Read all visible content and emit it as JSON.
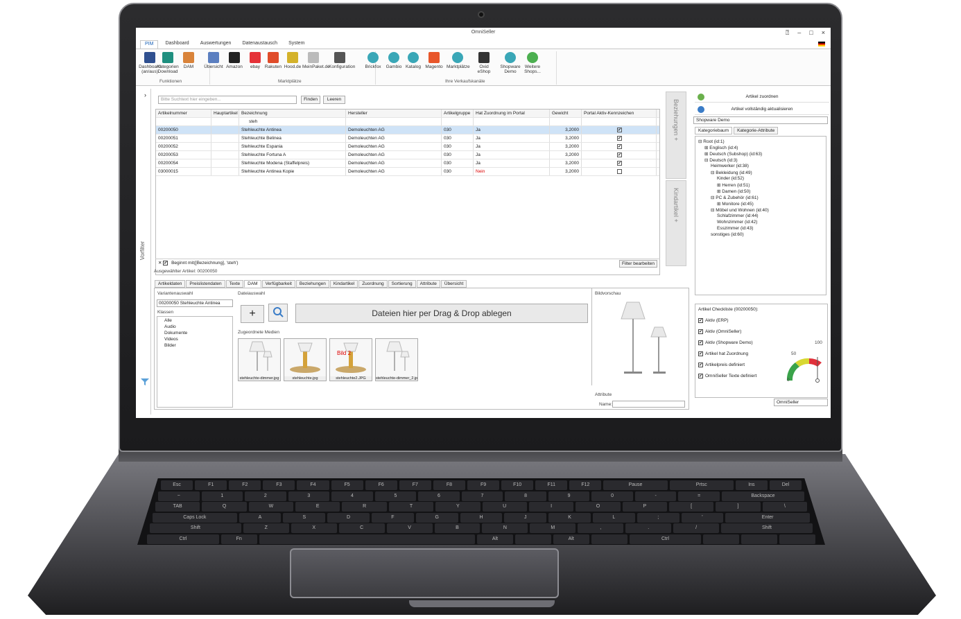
{
  "window": {
    "title": "OmniSeller"
  },
  "menu": [
    "PIM",
    "Dashboard",
    "Auswertungen",
    "Datenaustausch",
    "System"
  ],
  "ribbon": {
    "groups": [
      "Funktionen",
      "Marktplätze",
      "Ihre Verkaufskanäle"
    ],
    "buttons": [
      {
        "label": "Dashboard (an/aus)",
        "icon": "dashboard-icon",
        "color": "#2f4f8f"
      },
      {
        "label": "Kategorien Download",
        "icon": "download-icon",
        "color": "#1f8f7f"
      },
      {
        "label": "DAM",
        "icon": "image-icon",
        "color": "#d9833a"
      },
      {
        "label": "Übersicht",
        "icon": "grid-icon",
        "color": "#5b7fc0"
      },
      {
        "label": "Amazon",
        "icon": "amazon-icon",
        "color": "#222222"
      },
      {
        "label": "ebay",
        "icon": "ebay-icon",
        "color": "#e53238"
      },
      {
        "label": "Rakuten",
        "icon": "cart-icon",
        "color": "#e04c2a"
      },
      {
        "label": "Hood.de",
        "icon": "hood-icon",
        "color": "#d4b22a"
      },
      {
        "label": "MeinPaket.de",
        "icon": "truck-icon",
        "color": "#bbbbbb"
      },
      {
        "label": "Konfiguration",
        "icon": "wrench-icon",
        "color": "#555555"
      },
      {
        "label": "Brickfox",
        "icon": "globe-icon",
        "color": "#3aa7b7"
      },
      {
        "label": "Gambio",
        "icon": "globe-icon",
        "color": "#3aa7b7"
      },
      {
        "label": "Katalog",
        "icon": "globe-icon",
        "color": "#3aa7b7"
      },
      {
        "label": "Magento",
        "icon": "magento-icon",
        "color": "#e8562a"
      },
      {
        "label": "Marktplätze",
        "icon": "globe-icon",
        "color": "#3aa7b7"
      },
      {
        "label": "Oxid eShop",
        "icon": "oxid-icon",
        "color": "#333333"
      },
      {
        "label": "Shopware Demo",
        "icon": "globe-icon",
        "color": "#3aa7b7"
      },
      {
        "label": "Weitere Shops...",
        "icon": "plus-icon",
        "color": "#4caf50"
      }
    ]
  },
  "sidebar": {
    "vorfilter": "Vorfilter"
  },
  "search": {
    "placeholder": "Bitte Suchtext hier eingeben...",
    "find": "Finden",
    "clear": "Leeren"
  },
  "grid": {
    "columns": [
      "Artikelnummer",
      "Hauptartikel",
      "Bezeichnung",
      "Hersteller",
      "Artikelgruppe",
      "Hat Zuordnung im Portal",
      "Gewicht",
      "Portal Aktiv-Kennzeichen"
    ],
    "filter_value": "steh",
    "rows": [
      {
        "nr": "00200050",
        "bez": "Stehleuchte Antinea",
        "herst": "Demoleuchten AG",
        "grp": "030",
        "zuo": "Ja",
        "gew": "3,2000",
        "aktiv": true,
        "nein": false
      },
      {
        "nr": "00200051",
        "bez": "Stehleuchte Belinea",
        "herst": "Demoleuchten AG",
        "grp": "030",
        "zuo": "Ja",
        "gew": "3,2000",
        "aktiv": true,
        "nein": false
      },
      {
        "nr": "00200052",
        "bez": "Stehleuchte Espania",
        "herst": "Demoleuchten AG",
        "grp": "030",
        "zuo": "Ja",
        "gew": "3,2000",
        "aktiv": true,
        "nein": false
      },
      {
        "nr": "00200053",
        "bez": "Stehleuchte Fortuna A",
        "herst": "Demoleuchten AG",
        "grp": "030",
        "zuo": "Ja",
        "gew": "3,2000",
        "aktiv": true,
        "nein": false
      },
      {
        "nr": "00200054",
        "bez": "Stehleuchte Modena (Staffelpreis)",
        "herst": "Demoleuchten AG",
        "grp": "030",
        "zuo": "Ja",
        "gew": "3,2000",
        "aktiv": true,
        "nein": false
      },
      {
        "nr": "03000015",
        "bez": "Stehleuchte Antinea Kopie",
        "herst": "Demoleuchten AG",
        "grp": "030",
        "zuo": "Nein",
        "gew": "3,2000",
        "aktiv": false,
        "nein": true
      }
    ],
    "filter_text": "Beginnt mit([Bezeichnung], 'steh')",
    "filter_edit": "Filter bearbeiten",
    "selected_info": "Ausgewählter Artikel: 00200050"
  },
  "vpanels": {
    "beziehungen": "Beziehungen +",
    "kindartikel": "Kindartikel +"
  },
  "right": {
    "assign": "Artikel zuordnen",
    "update": "Artikel vollständig aktualisieren",
    "shop": "Shopware Demo",
    "tabs": [
      "Kategoriebaum",
      "Kategorie-Attribute"
    ],
    "tree": [
      {
        "label": "Root (id:1)",
        "depth": 0,
        "exp": "⊟"
      },
      {
        "label": "Englisch (id:4)",
        "depth": 1,
        "exp": "⊞"
      },
      {
        "label": "Deutsch (Subshop) (id:63)",
        "depth": 1,
        "exp": "⊞"
      },
      {
        "label": "Deutsch (id:3)",
        "depth": 1,
        "exp": "⊟"
      },
      {
        "label": "Heimwerker (id:38)",
        "depth": 2,
        "exp": ""
      },
      {
        "label": "Bekleidung (id:49)",
        "depth": 2,
        "exp": "⊟"
      },
      {
        "label": "Kinder (id:52)",
        "depth": 3,
        "exp": ""
      },
      {
        "label": "Herren (id:51)",
        "depth": 3,
        "exp": "⊞"
      },
      {
        "label": "Damen (id:50)",
        "depth": 3,
        "exp": "⊞"
      },
      {
        "label": "PC & Zubehör (id:61)",
        "depth": 2,
        "exp": "⊟"
      },
      {
        "label": "Monitore (id:45)",
        "depth": 3,
        "exp": "⊞"
      },
      {
        "label": "Möbel und Wohnen (id:40)",
        "depth": 2,
        "exp": "⊟"
      },
      {
        "label": "Schlafzimmer (id:44)",
        "depth": 3,
        "exp": ""
      },
      {
        "label": "Wohnzimmer (id:42)",
        "depth": 3,
        "exp": ""
      },
      {
        "label": "Esszimmer (id:43)",
        "depth": 3,
        "exp": ""
      },
      {
        "label": "sonstiges (id:60)",
        "depth": 2,
        "exp": ""
      }
    ],
    "checklist_title": "Artikel Checkliste (00200050):",
    "checklist": [
      "Aktiv (ERP)",
      "Aktiv (OmniSeller)",
      "Aktiv (Shopware Demo)",
      "Artikel hat Zuordnung",
      "Artikelpreis definiert",
      "OmniSeller Texte definiert"
    ],
    "gauge": {
      "min": "0",
      "mid": "50",
      "max": "100",
      "value": 100
    },
    "footer_select": "OmniSeller"
  },
  "bottom": {
    "tabs": [
      "Artikeldaten",
      "Preislistendaten",
      "Texte",
      "DAM",
      "Verfügbarkeit",
      "Beziehungen",
      "Kindartikel",
      "Zuordnung",
      "Sortierung",
      "Attribute",
      "Übersicht"
    ],
    "active_tab": "DAM",
    "variant_label": "Variantenauswahl",
    "variant_value": "00200050    Stehleuchte Antinea",
    "klassen_label": "Klassen",
    "klassen": [
      "Alle",
      "Audio",
      "Dokumente",
      "Videos",
      "Bilder"
    ],
    "dateiauswahl": "Dateiauswahl",
    "add": "+",
    "dropzone": "Dateien hier per Drag & Drop ablegen",
    "zugeordnete": "Zugeordnete Medien",
    "media": [
      {
        "name": "stehleuchte-dimmer.jpg",
        "badge": ""
      },
      {
        "name": "stehleuchte.jpg",
        "badge": ""
      },
      {
        "name": "stehleuchte2.JPG",
        "badge": "Bild 2"
      },
      {
        "name": "stehleuchte-dimmer_2.jpg",
        "badge": ""
      }
    ],
    "bildvorschau": "Bildvorschau",
    "attribute": "Attribute",
    "name_label": "Name:"
  },
  "keyboard": {
    "rows": [
      [
        "Esc",
        "F1",
        "F2",
        "F3",
        "F4",
        "F5",
        "F6",
        "F7",
        "F8",
        "F9",
        "F10",
        "F11",
        "F12",
        "Pause",
        "Prtsc",
        "Ins",
        "Del"
      ],
      [
        "~",
        "1",
        "2",
        "3",
        "4",
        "5",
        "6",
        "7",
        "8",
        "9",
        "0",
        "-",
        "=",
        "Backspace"
      ],
      [
        "TAB",
        "Q",
        "W",
        "E",
        "R",
        "T",
        "Y",
        "U",
        "I",
        "O",
        "P",
        "[",
        "]",
        "\\"
      ],
      [
        "Caps Lock",
        "A",
        "S",
        "D",
        "F",
        "G",
        "H",
        "J",
        "K",
        "L",
        ";",
        "'",
        "Enter"
      ],
      [
        "Shift",
        "Z",
        "X",
        "C",
        "V",
        "B",
        "N",
        "M",
        ",",
        ".",
        "/",
        "Shift"
      ],
      [
        "Ctrl",
        "Fn",
        "",
        "Alt",
        "",
        "Alt",
        "",
        "Ctrl",
        "",
        "",
        ""
      ]
    ]
  }
}
